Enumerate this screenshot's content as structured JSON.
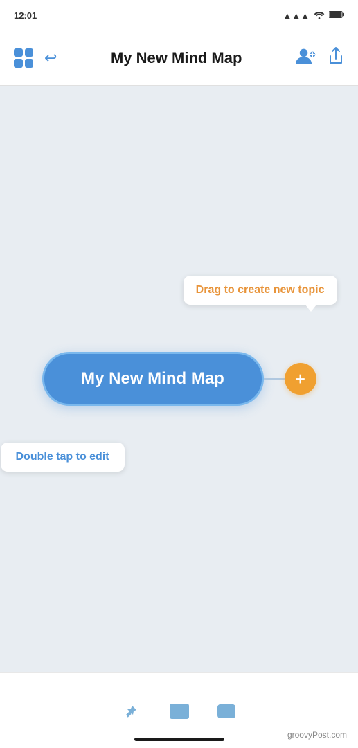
{
  "status_bar": {
    "time": "12:01",
    "signal": "●●●",
    "wifi": "WiFi",
    "battery": "100%"
  },
  "header": {
    "title": "My New Mind Map",
    "undo_label": "Undo",
    "add_person_label": "Add person",
    "share_label": "Share"
  },
  "canvas": {
    "node_text": "My New Mind Map",
    "drag_tooltip": "Drag to create new topic",
    "edit_tooltip": "Double tap to edit"
  },
  "toolbar": {
    "icon1_name": "pin-icon",
    "icon2_name": "image-icon",
    "icon3_name": "menu-icon"
  },
  "watermark": {
    "text": "groovyPost.com"
  },
  "colors": {
    "accent_blue": "#4a90d9",
    "accent_orange": "#f0a030",
    "tooltip_orange": "#e8943a",
    "bg": "#e8edf2"
  }
}
